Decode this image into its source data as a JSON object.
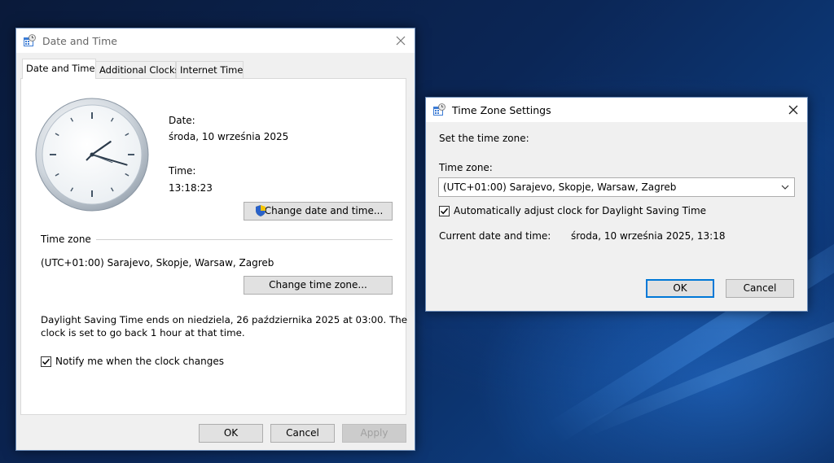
{
  "dt_window": {
    "title": "Date and Time",
    "tabs": [
      "Date and Time",
      "Additional Clocks",
      "Internet Time"
    ],
    "date_label": "Date:",
    "date_value": "środa, 10 września 2025",
    "time_label": "Time:",
    "time_value": "13:18:23",
    "change_datetime_button": "Change date and time...",
    "timezone_heading": "Time zone",
    "timezone_value": "(UTC+01:00) Sarajevo, Skopje, Warsaw, Zagreb",
    "change_timezone_button": "Change time zone...",
    "dst_line1": "Daylight Saving Time ends on niedziela, 26 października 2025 at 03:00. The",
    "dst_line2": "clock is set to go back 1 hour at that time.",
    "notify_label": "Notify me when the clock changes",
    "notify_checked": true,
    "ok_button": "OK",
    "cancel_button": "Cancel",
    "apply_button": "Apply"
  },
  "tz_window": {
    "title": "Time Zone Settings",
    "set_label": "Set the time zone:",
    "timezone_label": "Time zone:",
    "timezone_selected": "(UTC+01:00) Sarajevo, Skopje, Warsaw, Zagreb",
    "auto_dst_label": "Automatically adjust clock for Daylight Saving Time",
    "auto_dst_checked": true,
    "current_label": "Current date and time:",
    "current_value": "środa, 10 września 2025, 13:18",
    "ok_button": "OK",
    "cancel_button": "Cancel"
  },
  "icons": {
    "window_icon": "date-time-control-panel-icon",
    "close": "close-icon",
    "shield": "uac-shield-icon",
    "dropdown": "chevron-down-icon",
    "clock": "analog-clock"
  },
  "colors": {
    "accent": "#0078d7",
    "dialog_bg": "#f0f0f0"
  }
}
